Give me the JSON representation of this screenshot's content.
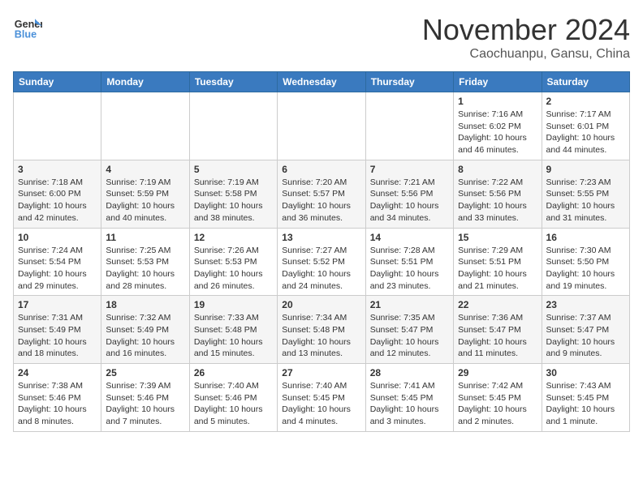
{
  "header": {
    "logo_line1": "General",
    "logo_line2": "Blue",
    "month": "November 2024",
    "location": "Caochuanpu, Gansu, China"
  },
  "weekdays": [
    "Sunday",
    "Monday",
    "Tuesday",
    "Wednesday",
    "Thursday",
    "Friday",
    "Saturday"
  ],
  "weeks": [
    [
      {
        "day": "",
        "info": ""
      },
      {
        "day": "",
        "info": ""
      },
      {
        "day": "",
        "info": ""
      },
      {
        "day": "",
        "info": ""
      },
      {
        "day": "",
        "info": ""
      },
      {
        "day": "1",
        "info": "Sunrise: 7:16 AM\nSunset: 6:02 PM\nDaylight: 10 hours\nand 46 minutes."
      },
      {
        "day": "2",
        "info": "Sunrise: 7:17 AM\nSunset: 6:01 PM\nDaylight: 10 hours\nand 44 minutes."
      }
    ],
    [
      {
        "day": "3",
        "info": "Sunrise: 7:18 AM\nSunset: 6:00 PM\nDaylight: 10 hours\nand 42 minutes."
      },
      {
        "day": "4",
        "info": "Sunrise: 7:19 AM\nSunset: 5:59 PM\nDaylight: 10 hours\nand 40 minutes."
      },
      {
        "day": "5",
        "info": "Sunrise: 7:19 AM\nSunset: 5:58 PM\nDaylight: 10 hours\nand 38 minutes."
      },
      {
        "day": "6",
        "info": "Sunrise: 7:20 AM\nSunset: 5:57 PM\nDaylight: 10 hours\nand 36 minutes."
      },
      {
        "day": "7",
        "info": "Sunrise: 7:21 AM\nSunset: 5:56 PM\nDaylight: 10 hours\nand 34 minutes."
      },
      {
        "day": "8",
        "info": "Sunrise: 7:22 AM\nSunset: 5:56 PM\nDaylight: 10 hours\nand 33 minutes."
      },
      {
        "day": "9",
        "info": "Sunrise: 7:23 AM\nSunset: 5:55 PM\nDaylight: 10 hours\nand 31 minutes."
      }
    ],
    [
      {
        "day": "10",
        "info": "Sunrise: 7:24 AM\nSunset: 5:54 PM\nDaylight: 10 hours\nand 29 minutes."
      },
      {
        "day": "11",
        "info": "Sunrise: 7:25 AM\nSunset: 5:53 PM\nDaylight: 10 hours\nand 28 minutes."
      },
      {
        "day": "12",
        "info": "Sunrise: 7:26 AM\nSunset: 5:53 PM\nDaylight: 10 hours\nand 26 minutes."
      },
      {
        "day": "13",
        "info": "Sunrise: 7:27 AM\nSunset: 5:52 PM\nDaylight: 10 hours\nand 24 minutes."
      },
      {
        "day": "14",
        "info": "Sunrise: 7:28 AM\nSunset: 5:51 PM\nDaylight: 10 hours\nand 23 minutes."
      },
      {
        "day": "15",
        "info": "Sunrise: 7:29 AM\nSunset: 5:51 PM\nDaylight: 10 hours\nand 21 minutes."
      },
      {
        "day": "16",
        "info": "Sunrise: 7:30 AM\nSunset: 5:50 PM\nDaylight: 10 hours\nand 19 minutes."
      }
    ],
    [
      {
        "day": "17",
        "info": "Sunrise: 7:31 AM\nSunset: 5:49 PM\nDaylight: 10 hours\nand 18 minutes."
      },
      {
        "day": "18",
        "info": "Sunrise: 7:32 AM\nSunset: 5:49 PM\nDaylight: 10 hours\nand 16 minutes."
      },
      {
        "day": "19",
        "info": "Sunrise: 7:33 AM\nSunset: 5:48 PM\nDaylight: 10 hours\nand 15 minutes."
      },
      {
        "day": "20",
        "info": "Sunrise: 7:34 AM\nSunset: 5:48 PM\nDaylight: 10 hours\nand 13 minutes."
      },
      {
        "day": "21",
        "info": "Sunrise: 7:35 AM\nSunset: 5:47 PM\nDaylight: 10 hours\nand 12 minutes."
      },
      {
        "day": "22",
        "info": "Sunrise: 7:36 AM\nSunset: 5:47 PM\nDaylight: 10 hours\nand 11 minutes."
      },
      {
        "day": "23",
        "info": "Sunrise: 7:37 AM\nSunset: 5:47 PM\nDaylight: 10 hours\nand 9 minutes."
      }
    ],
    [
      {
        "day": "24",
        "info": "Sunrise: 7:38 AM\nSunset: 5:46 PM\nDaylight: 10 hours\nand 8 minutes."
      },
      {
        "day": "25",
        "info": "Sunrise: 7:39 AM\nSunset: 5:46 PM\nDaylight: 10 hours\nand 7 minutes."
      },
      {
        "day": "26",
        "info": "Sunrise: 7:40 AM\nSunset: 5:46 PM\nDaylight: 10 hours\nand 5 minutes."
      },
      {
        "day": "27",
        "info": "Sunrise: 7:40 AM\nSunset: 5:45 PM\nDaylight: 10 hours\nand 4 minutes."
      },
      {
        "day": "28",
        "info": "Sunrise: 7:41 AM\nSunset: 5:45 PM\nDaylight: 10 hours\nand 3 minutes."
      },
      {
        "day": "29",
        "info": "Sunrise: 7:42 AM\nSunset: 5:45 PM\nDaylight: 10 hours\nand 2 minutes."
      },
      {
        "day": "30",
        "info": "Sunrise: 7:43 AM\nSunset: 5:45 PM\nDaylight: 10 hours\nand 1 minute."
      }
    ]
  ]
}
